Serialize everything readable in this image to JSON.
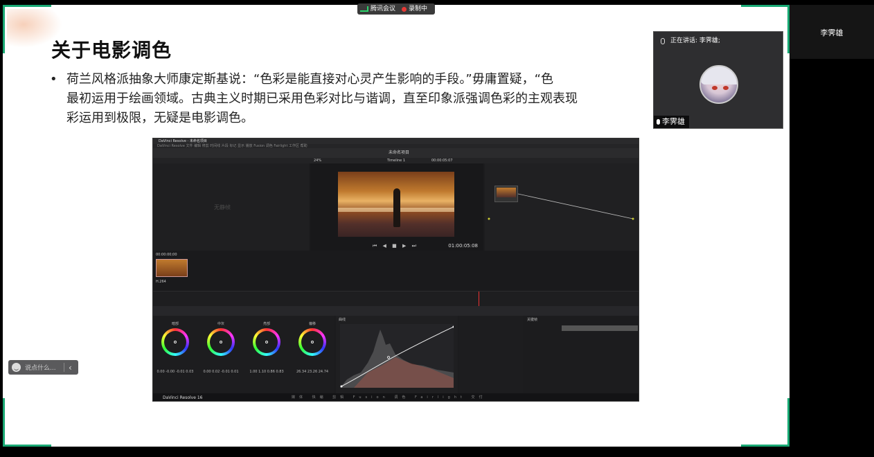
{
  "meeting": {
    "app_name": "腾讯会议",
    "recording_label": "录制中",
    "colors": {
      "accent": "#19a974",
      "recording": "#e53935"
    }
  },
  "slide": {
    "title": "关于电影调色",
    "bullet": "•",
    "lines": [
      "荷兰风格派抽象大师康定斯基说：“色彩是能直接对心灵产生影响的手段。”毋庸置疑，“色",
      "最初运用于绘画领域。古典主义时期已采用色彩对比与谐调，直至印象派强调色彩的主观表现",
      "彩运用到极限，无疑是电影调色。"
    ]
  },
  "resolve": {
    "window_title": "DaVinci Resolve - 未命名项目",
    "menu": "DaVinci Resolve   文件   编辑   修剪   时间线   片段   标记   显示   播放   Fusion   调色   Fairlight   工作区   帮助",
    "project_name": "未命名项目",
    "zoom": "24%",
    "timeline_name": "Timeline 1",
    "viewer_timecode": "01:00:05:08",
    "top_timecode": "00:00:05:07",
    "gallery_note": "无静帧",
    "clip_timecode": "00:00:00;00",
    "clip_codec": "H.264",
    "wheels": [
      {
        "label": "暗部",
        "values": "0.00  -0.00  -0.01  0.03"
      },
      {
        "label": "中灰",
        "values": "0.00  0.02  -0.01  0.01"
      },
      {
        "label": "亮部",
        "values": "1.00  1.10  0.86  0.83"
      },
      {
        "label": "偏移",
        "values": "26.34  23.26  24.74"
      }
    ],
    "curves_label": "曲线",
    "keyframes_label": "关键帧",
    "footer_app": "DaVinci Resolve 16",
    "footer_pages": "媒体 快编 剪辑 Fusion 调色 Fairlight 交付"
  },
  "speaker": {
    "speaking_label": "正在讲话: 李霁雄;",
    "name": "李霁雄"
  },
  "participant": {
    "name": "李霁雄"
  },
  "chat": {
    "placeholder": "说点什么...",
    "collapse_icon": "‹"
  }
}
